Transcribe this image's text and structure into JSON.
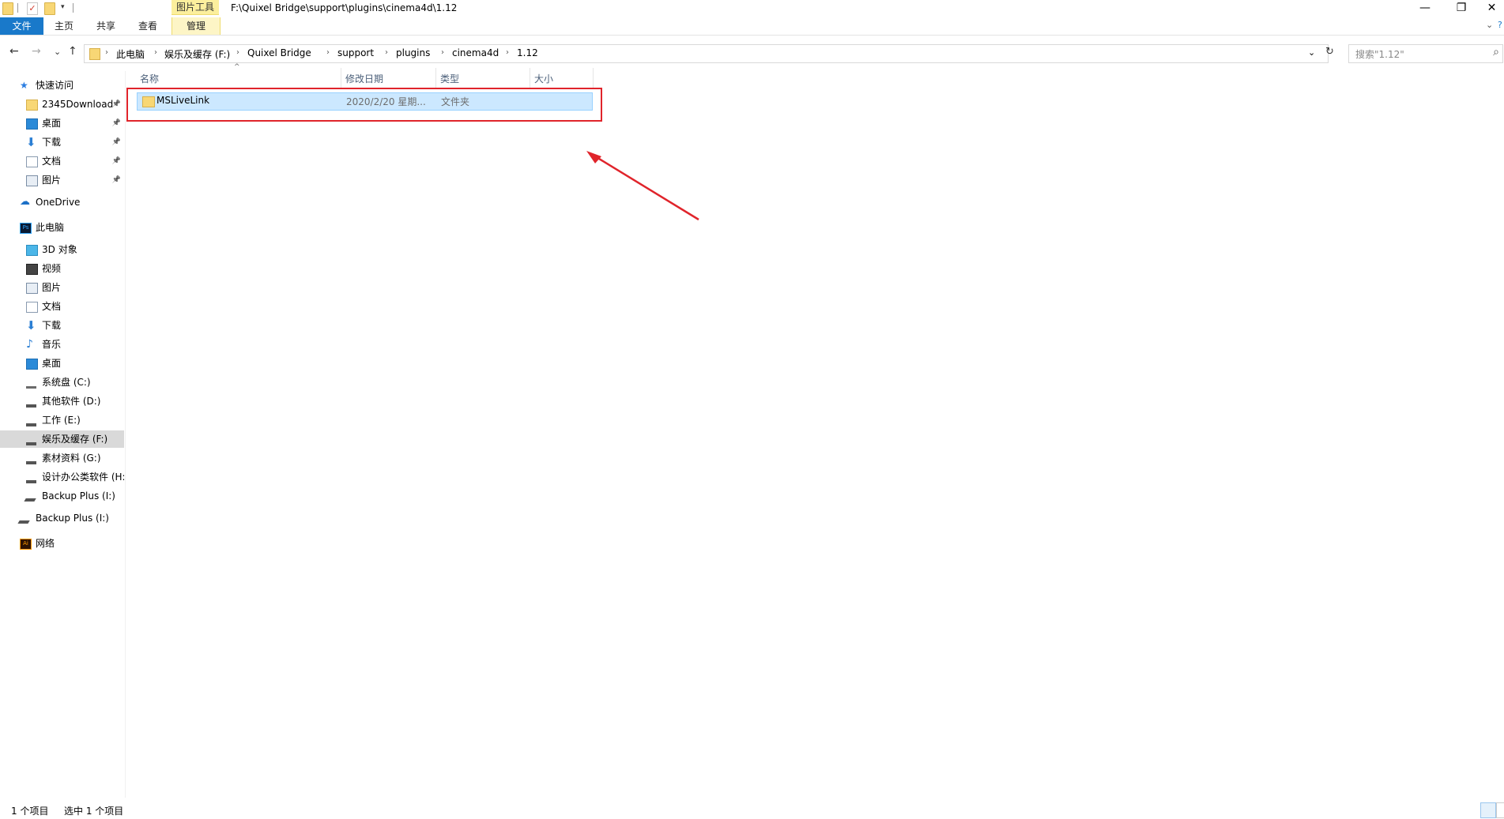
{
  "window": {
    "context_tab": "图片工具",
    "title": "F:\\Quixel Bridge\\support\\plugins\\cinema4d\\1.12",
    "minimize": "—",
    "restore": "❐",
    "close": "✕"
  },
  "ribbon": {
    "tabs": [
      "文件",
      "主页",
      "共享",
      "查看",
      "管理"
    ],
    "expand_icon": "⌄",
    "help_icon": "?"
  },
  "nav": {
    "back": "←",
    "forward": "→",
    "recent": "⌄",
    "up": "↑",
    "breadcrumbs": [
      "此电脑",
      "娱乐及缓存 (F:)",
      "Quixel Bridge",
      "support",
      "plugins",
      "cinema4d",
      "1.12"
    ],
    "dropdown": "⌄",
    "refresh": "↻",
    "search_placeholder": "搜索\"1.12\"",
    "search_icon": "⌕"
  },
  "sidebar": {
    "items": [
      {
        "label": "快速访问",
        "icon": "star-icon",
        "level": 0,
        "pinned": false
      },
      {
        "label": "2345Download",
        "icon": "folder-icon",
        "level": 1,
        "pinned": true
      },
      {
        "label": "桌面",
        "icon": "desktop-icon",
        "level": 1,
        "pinned": true
      },
      {
        "label": "下载",
        "icon": "download-icon",
        "level": 1,
        "pinned": true
      },
      {
        "label": "文档",
        "icon": "document-icon",
        "level": 1,
        "pinned": true
      },
      {
        "label": "图片",
        "icon": "picture-icon",
        "level": 1,
        "pinned": true
      },
      {
        "label": "OneDrive",
        "icon": "cloud-icon",
        "level": 0,
        "pinned": false
      },
      {
        "label": "此电脑",
        "icon": "ps-icon",
        "level": 0,
        "pinned": false
      },
      {
        "label": "3D 对象",
        "icon": "cube-icon",
        "level": 1,
        "pinned": false
      },
      {
        "label": "视频",
        "icon": "video-icon",
        "level": 1,
        "pinned": false
      },
      {
        "label": "图片",
        "icon": "picture-icon",
        "level": 1,
        "pinned": false
      },
      {
        "label": "文档",
        "icon": "document-icon",
        "level": 1,
        "pinned": false
      },
      {
        "label": "下载",
        "icon": "download-icon",
        "level": 1,
        "pinned": false
      },
      {
        "label": "音乐",
        "icon": "music-icon",
        "level": 1,
        "pinned": false
      },
      {
        "label": "桌面",
        "icon": "desktop-icon",
        "level": 1,
        "pinned": false
      },
      {
        "label": "系统盘 (C:)",
        "icon": "system-drive-icon",
        "level": 1,
        "pinned": false
      },
      {
        "label": "其他软件 (D:)",
        "icon": "drive-icon",
        "level": 1,
        "pinned": false
      },
      {
        "label": "工作 (E:)",
        "icon": "drive-icon",
        "level": 1,
        "pinned": false
      },
      {
        "label": "娱乐及缓存 (F:)",
        "icon": "drive-icon",
        "level": 1,
        "pinned": false,
        "selected": true
      },
      {
        "label": "素材资料 (G:)",
        "icon": "drive-icon",
        "level": 1,
        "pinned": false
      },
      {
        "label": "设计办公类软件 (H:",
        "icon": "drive-icon",
        "level": 1,
        "pinned": false
      },
      {
        "label": "Backup Plus (I:)",
        "icon": "external-drive-icon",
        "level": 1,
        "pinned": false
      },
      {
        "label": "Backup Plus (I:)",
        "icon": "external-drive-icon",
        "level": 0,
        "pinned": false
      },
      {
        "label": "网络",
        "icon": "ai-icon",
        "level": 0,
        "pinned": false
      }
    ]
  },
  "content": {
    "columns": [
      "名称",
      "修改日期",
      "类型",
      "大小"
    ],
    "sort_indicator": "^",
    "rows": [
      {
        "name": "MSLiveLink",
        "modified": "2020/2/20 星期...",
        "type": "文件夹",
        "size": ""
      }
    ]
  },
  "status": {
    "item_count": "1 个项目",
    "selected": "选中 1 个项目"
  },
  "colors": {
    "file_tab": "#1979ca",
    "context_tab": "#fcef9d",
    "selection": "#cce8ff",
    "annotation": "#e0242b"
  }
}
